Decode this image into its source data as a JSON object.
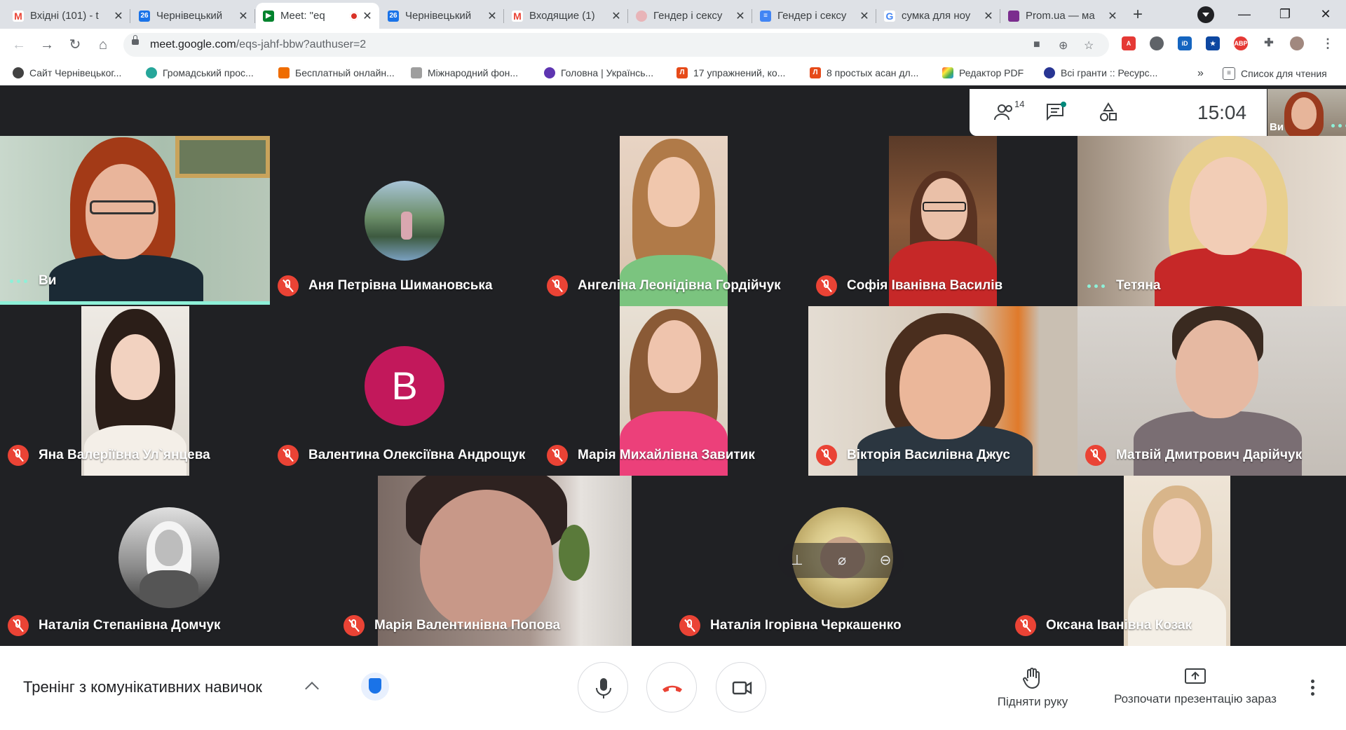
{
  "browser": {
    "tabs": [
      {
        "title": "Вхідні (101) - t",
        "favicon": "gmail-icon",
        "active": false
      },
      {
        "title": "Чернівецький",
        "favicon": "calendar-icon",
        "active": false
      },
      {
        "title": "Meet: \"eq",
        "favicon": "meet-icon",
        "active": true
      },
      {
        "title": "Чернівецький",
        "favicon": "calendar-icon",
        "active": false
      },
      {
        "title": "Входящие (1)",
        "favicon": "gmail-icon",
        "active": false
      },
      {
        "title": "Гендер і сексу",
        "favicon": "web-icon",
        "active": false
      },
      {
        "title": "Гендер і сексу",
        "favicon": "docs-icon",
        "active": false
      },
      {
        "title": "сумка для ноу",
        "favicon": "google-icon",
        "active": false
      },
      {
        "title": "Prom.ua — ма",
        "favicon": "prom-icon",
        "active": false
      }
    ],
    "url_host": "meet.google.com",
    "url_path": "/eqs-jahf-bbw?authuser=2",
    "bookmarks": [
      "Сайт Чернівецьког...",
      "Громадський прос...",
      "Бесплатный онлайн...",
      "Міжнародний фон...",
      "Головна | Українсь...",
      "17 упражнений, ко...",
      "8 простых асан дл...",
      "Редактор PDF",
      "Всі гранти :: Ресурс..."
    ],
    "bookmarks_more": "»",
    "reading_list": "Список для чтения"
  },
  "meet": {
    "participants_count": "14",
    "clock": "15:04",
    "self_label": "Ви",
    "participants": [
      {
        "name": "Ви",
        "muted": false
      },
      {
        "name": "Аня Петрівна Шимановська",
        "muted": true
      },
      {
        "name": "Ангеліна Леонідівна Гордійчук",
        "muted": true
      },
      {
        "name": "Софія Іванівна Василів",
        "muted": true
      },
      {
        "name": "Тетяна",
        "muted": false
      },
      {
        "name": "Яна Валеріївна Ул`янцева",
        "muted": true
      },
      {
        "name": "Валентина Олексіївна Андрощук",
        "muted": true
      },
      {
        "name": "Марія Михайлівна Завитик",
        "muted": true
      },
      {
        "name": "Вікторія Василівна Джус",
        "muted": true
      },
      {
        "name": "Матвій Дмитрович Дарійчук",
        "muted": true
      },
      {
        "name": "Наталія Степанівна Домчук",
        "muted": true
      },
      {
        "name": "Марія Валентинівна Попова",
        "muted": true
      },
      {
        "name": "Наталія Ігорівна Черкашенко",
        "muted": true
      },
      {
        "name": "Оксана Іванівна Козак",
        "muted": true
      }
    ],
    "letter_avatar": "В",
    "meeting_title": "Тренінг з комунікативних навичок",
    "raise_hand": "Підняти руку",
    "present_now": "Розпочати презентацію зараз"
  },
  "colors": {
    "accent": "#1a73e8",
    "hangup": "#ea4335",
    "avatar": "#c2185b",
    "speaking": "#8ef0d8"
  }
}
